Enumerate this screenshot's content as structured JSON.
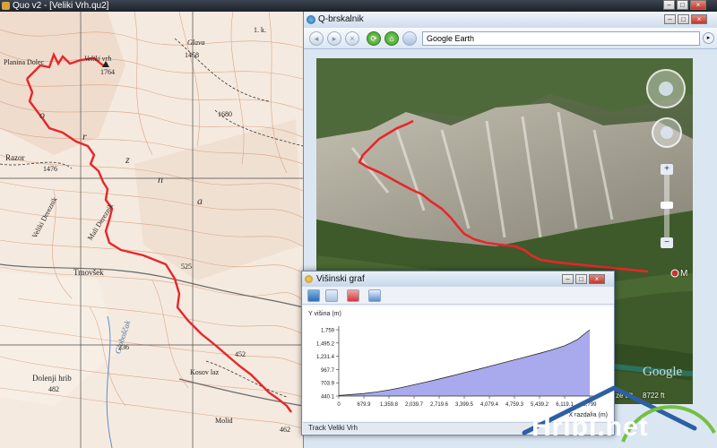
{
  "window": {
    "title": "Quo v2 - [Veliki Vrh.qu2]",
    "controls": [
      "–",
      "□",
      "×"
    ]
  },
  "map": {
    "labels": {
      "planina": "Planina Dolec",
      "veliki_vrh": "Veliki vrh",
      "veliki_vrh_elev": "1764",
      "glava": "Glava",
      "glava_elev": "1458",
      "elev_1680": "1680",
      "o": "o",
      "r": "r",
      "z": "z",
      "n": "n",
      "a": "a",
      "razor": "Razor",
      "elev_1476": "1476",
      "veliki_dereznik": "Veliki Dereznik",
      "mali_dereznik": "Mali Dereznik",
      "trnovsek": "Trnovšek",
      "elev_525": "525",
      "globoscak": "Globoščak",
      "elev_236": "236",
      "elev_452": "452",
      "dolenji": "Dolenji hrib",
      "elev_482": "482",
      "kosov": "Kosov laz",
      "molid": "Molid",
      "elev_462": "462",
      "corner_text": "1. k."
    },
    "colors": {
      "track": "#e8262a",
      "contour": "#d59a78",
      "grid": "#4a4a4a"
    }
  },
  "browser": {
    "title": "Q-brskalnik",
    "address": "Google Earth",
    "go_glyph": "▸",
    "nav_glyphs": [
      "◂",
      "▸",
      "×",
      "⟳",
      "⌂"
    ],
    "earth": {
      "eye_alt_label": "ze alt",
      "eye_alt_value": "8722 ft",
      "brand": "Google",
      "marker_label": "M"
    },
    "controls": [
      "–",
      "□",
      "×"
    ]
  },
  "graph": {
    "title": "Višinski graf",
    "controls": [
      "–",
      "□",
      "×"
    ],
    "status": "Track Veliki Vrh",
    "chart_data": {
      "type": "area",
      "title": "",
      "ylabel": "Y višina (m)",
      "xlabel": "X razdalja (m)",
      "y_ticks": [
        "440.1",
        "703.9",
        "967.7",
        "1,231.4",
        "1,495.2",
        "1,759"
      ],
      "x_ticks": [
        "0",
        "679.9",
        "1,359.8",
        "2,039.7",
        "2,719.6",
        "3,399.5",
        "4,079.4",
        "4,759.3",
        "5,439.2",
        "6,119.1",
        "6,799"
      ],
      "ylim": [
        440.1,
        1759
      ],
      "xlim": [
        0,
        6799
      ],
      "x": [
        0,
        340,
        680,
        1020,
        1360,
        1700,
        2040,
        2380,
        2720,
        3060,
        3400,
        3740,
        4080,
        4420,
        4760,
        5100,
        5440,
        5780,
        6120,
        6460,
        6799
      ],
      "y": [
        452,
        470,
        490,
        520,
        560,
        610,
        665,
        720,
        780,
        840,
        905,
        965,
        1030,
        1095,
        1160,
        1225,
        1290,
        1360,
        1440,
        1560,
        1759
      ],
      "fill": "#a9a9ee",
      "line": "#2a2a2a",
      "grid": false,
      "legend": "none"
    }
  },
  "watermark": {
    "text": "Hribi.net",
    "green": "#74c043",
    "blue": "#2d5fa3"
  }
}
